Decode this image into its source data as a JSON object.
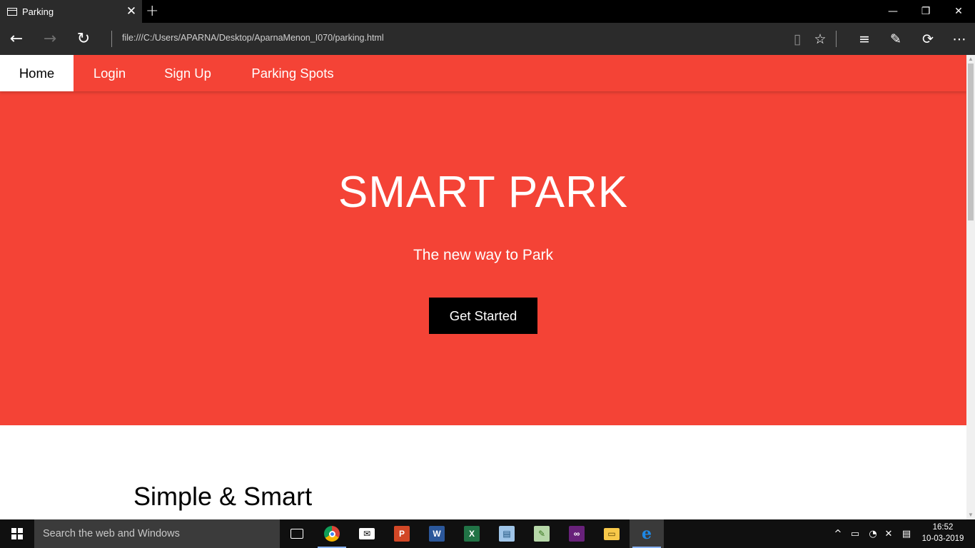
{
  "browser": {
    "tab_title": "Parking",
    "address": "file:///C:/Users/APARNA/Desktop/AparnaMenon_I070/parking.html"
  },
  "site": {
    "nav": [
      {
        "label": "Home",
        "active": true
      },
      {
        "label": "Login",
        "active": false
      },
      {
        "label": "Sign Up",
        "active": false
      },
      {
        "label": "Parking Spots",
        "active": false
      }
    ],
    "hero": {
      "title": "SMART PARK",
      "subtitle": "The new way to Park",
      "cta": "Get Started",
      "background": "#f44336"
    },
    "section_title": "Simple & Smart"
  },
  "taskbar": {
    "search_placeholder": "Search the web and Windows",
    "time": "16:52",
    "date": "10-03-2019"
  }
}
